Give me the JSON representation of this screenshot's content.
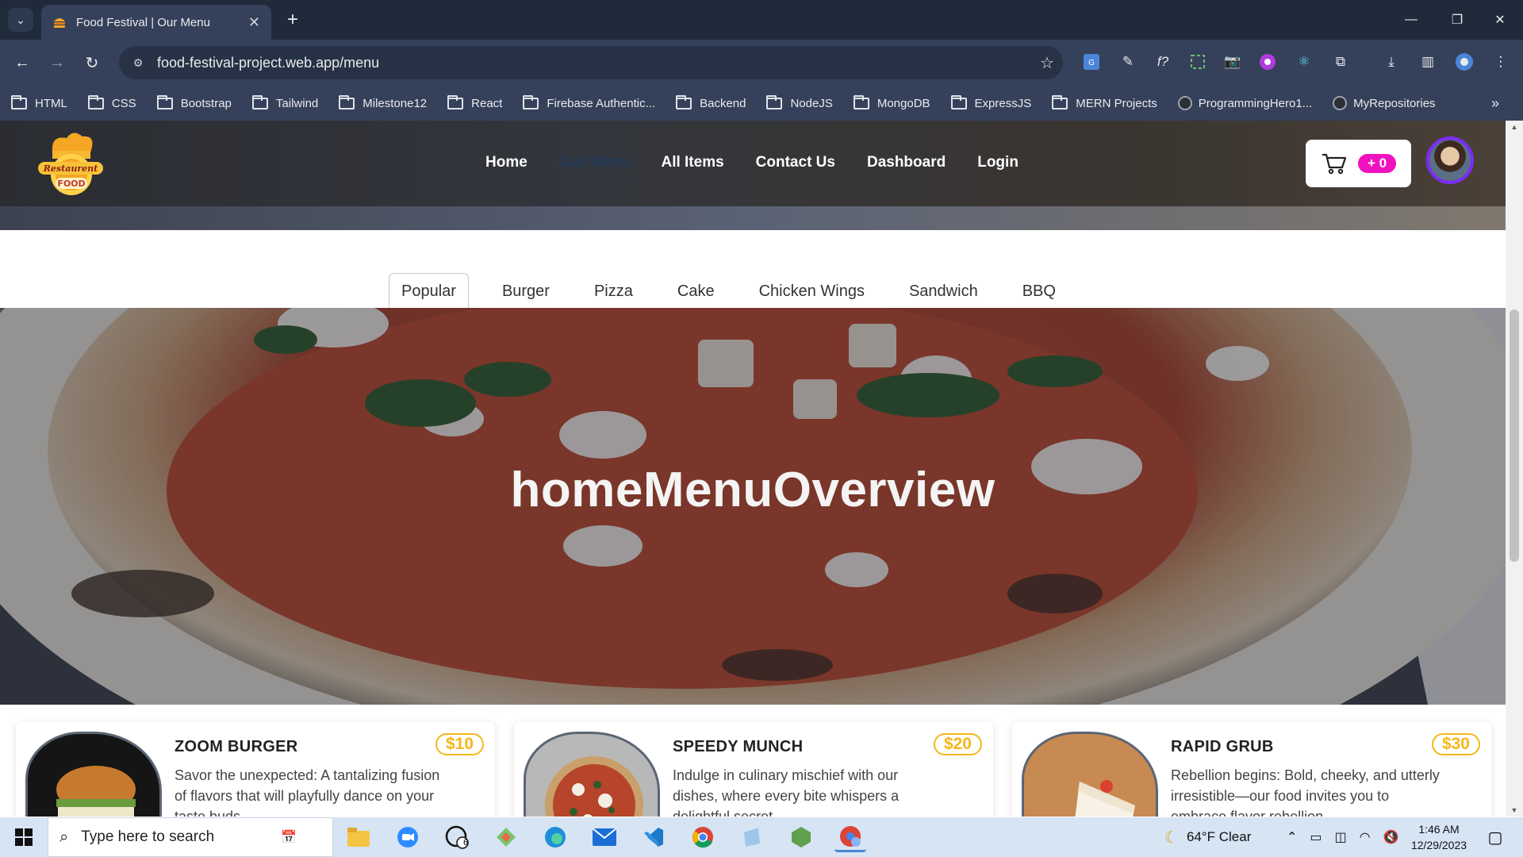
{
  "browser": {
    "tab_title": "Food Festival | Our Menu",
    "url": "food-festival-project.web.app/menu",
    "bookmarks": [
      "HTML",
      "CSS",
      "Bootstrap",
      "Tailwind",
      "Milestone12",
      "React",
      "Firebase Authentic...",
      "Backend",
      "NodeJS",
      "MongoDB",
      "ExpressJS",
      "MERN Projects"
    ],
    "github_bookmarks": [
      "ProgrammingHero1...",
      "MyRepositories"
    ],
    "extensions": [
      "translate-icon",
      "eyedropper-icon",
      "function-icon",
      "screenshot-icon",
      "camera-icon",
      "podcast-icon",
      "react-icon",
      "puzzle-icon"
    ]
  },
  "site": {
    "logo_text": "Restaurent FOOD",
    "nav": [
      "Home",
      "Our Menu",
      "All Items",
      "Contact Us",
      "Dashboard",
      "Login"
    ],
    "cart_count": "+ 0",
    "accent_color": "#f012be"
  },
  "menu": {
    "tabs": [
      "Popular",
      "Burger",
      "Pizza",
      "Cake",
      "Chicken Wings",
      "Sandwich",
      "BBQ"
    ],
    "active_tab": "Popular",
    "hero_title": "homeMenuOverview",
    "items": [
      {
        "name": "ZOOM BURGER",
        "price": "$10",
        "desc": "Savor the unexpected: A tantalizing fusion of flavors that will playfully dance on your taste buds"
      },
      {
        "name": "SPEEDY MUNCH",
        "price": "$20",
        "desc": "Indulge in culinary mischief with our dishes, where every bite whispers a delightful secret"
      },
      {
        "name": "RAPID GRUB",
        "price": "$30",
        "desc": "Rebellion begins: Bold, cheeky, and utterly irresistible—our food invites you to embrace flavor rebellion"
      }
    ]
  },
  "taskbar": {
    "search_placeholder": "Type here to search",
    "weather": "64°F  Clear",
    "time": "1:46 AM",
    "date": "12/29/2023",
    "whatsapp_badge": "6"
  }
}
